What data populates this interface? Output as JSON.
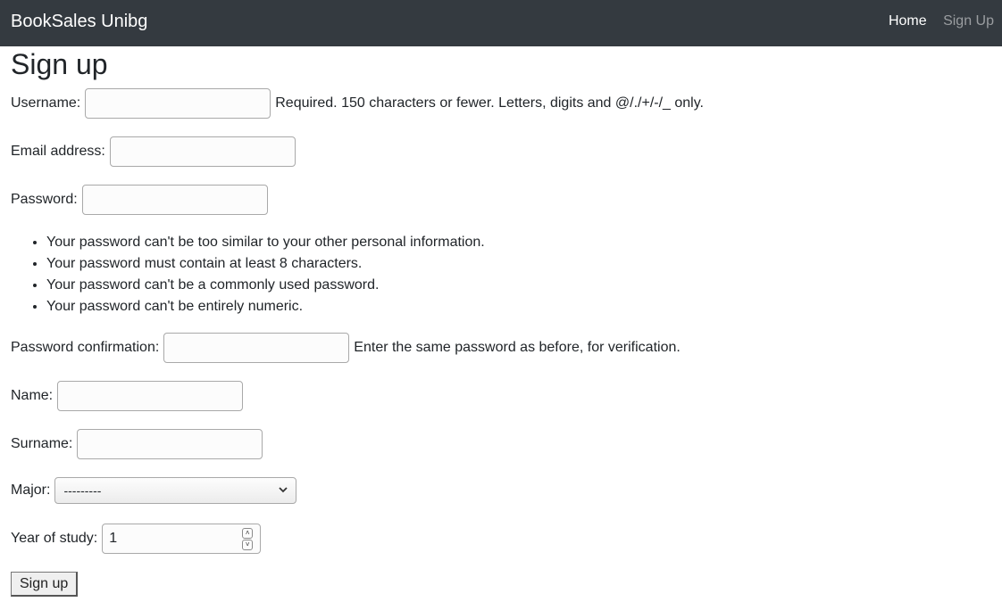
{
  "navbar": {
    "brand": "BookSales Unibg",
    "links": [
      {
        "label": "Home"
      },
      {
        "label": "Sign Up"
      }
    ]
  },
  "page_title": "Sign up",
  "form": {
    "username": {
      "label": "Username:",
      "value": "",
      "help": "Required. 150 characters or fewer. Letters, digits and @/./+/-/_ only."
    },
    "email": {
      "label": "Email address:",
      "value": ""
    },
    "password": {
      "label": "Password:",
      "value": "",
      "rules": [
        "Your password can't be too similar to your other personal information.",
        "Your password must contain at least 8 characters.",
        "Your password can't be a commonly used password.",
        "Your password can't be entirely numeric."
      ]
    },
    "password_confirmation": {
      "label": "Password confirmation:",
      "value": "",
      "help": "Enter the same password as before, for verification."
    },
    "name": {
      "label": "Name:",
      "value": ""
    },
    "surname": {
      "label": "Surname:",
      "value": ""
    },
    "major": {
      "label": "Major:",
      "selected": "---------"
    },
    "year_of_study": {
      "label": "Year of study:",
      "value": "1"
    },
    "submit_label": "Sign up"
  },
  "icons": {
    "major_dropdown": "chevron-down-icon",
    "year_spinner_up": "spinner-up-icon",
    "year_spinner_down": "spinner-down-icon"
  },
  "colors": {
    "navbar_bg": "#343a40",
    "nav_active": "#ffffff",
    "nav_inactive": "#9a9da0"
  }
}
